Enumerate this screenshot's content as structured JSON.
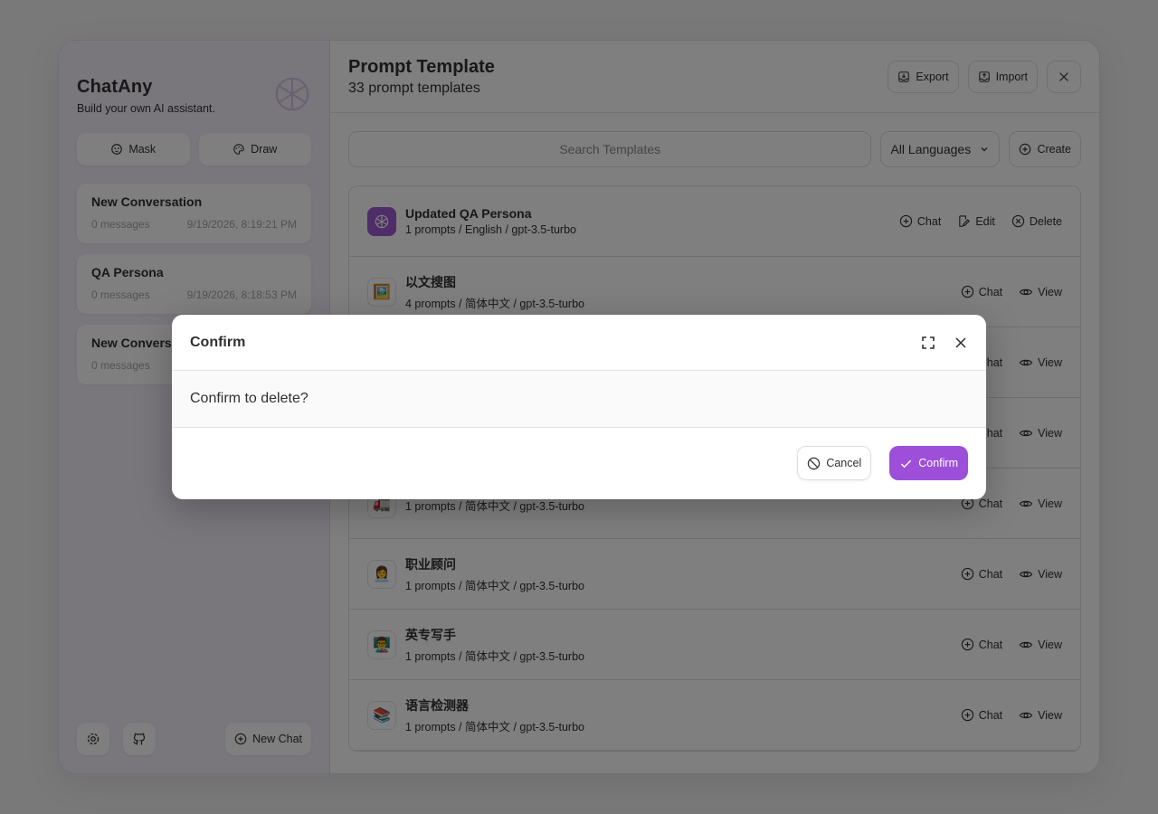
{
  "sidebar": {
    "brand_title": "ChatAny",
    "brand_subtitle": "Build your own AI assistant.",
    "mask_label": "Mask",
    "draw_label": "Draw",
    "chats": [
      {
        "title": "New Conversation",
        "count": "0 messages",
        "time": "9/19/2026, 8:19:21 PM"
      },
      {
        "title": "QA Persona",
        "count": "0 messages",
        "time": "9/19/2026, 8:18:53 PM"
      },
      {
        "title": "New Conversation",
        "count": "0 messages",
        "time": ""
      }
    ],
    "new_chat_label": "New Chat"
  },
  "main": {
    "title": "Prompt Template",
    "subtitle": "33 prompt templates",
    "export_label": "Export",
    "import_label": "Import",
    "search_placeholder": "Search Templates",
    "language_selected": "All Languages",
    "create_label": "Create",
    "templates": [
      {
        "name": "Updated QA Persona",
        "meta": "1 prompts / English / gpt-3.5-turbo",
        "icon": "openai-icon",
        "actions": [
          "Chat",
          "Edit",
          "Delete"
        ]
      },
      {
        "name": "以文搜图",
        "meta": "4 prompts / 简体中文 / gpt-3.5-turbo",
        "icon": "🖼️",
        "actions": [
          "Chat",
          "View"
        ]
      },
      {
        "name": "",
        "meta": "",
        "icon": "",
        "actions": [
          "Chat",
          "View"
        ]
      },
      {
        "name": "",
        "meta": "",
        "icon": "",
        "actions": [
          "Chat",
          "View"
        ]
      },
      {
        "name": "",
        "meta": "1 prompts / 简体中文 / gpt-3.5-turbo",
        "icon": "🚛",
        "actions": [
          "Chat",
          "View"
        ]
      },
      {
        "name": "职业顾问",
        "meta": "1 prompts / 简体中文 / gpt-3.5-turbo",
        "icon": "👩‍💼",
        "actions": [
          "Chat",
          "View"
        ]
      },
      {
        "name": "英专写手",
        "meta": "1 prompts / 简体中文 / gpt-3.5-turbo",
        "icon": "👨‍🏫",
        "actions": [
          "Chat",
          "View"
        ]
      },
      {
        "name": "语言检测器",
        "meta": "1 prompts / 简体中文 / gpt-3.5-turbo",
        "icon": "📚",
        "actions": [
          "Chat",
          "View"
        ]
      }
    ]
  },
  "modal": {
    "title": "Confirm",
    "message": "Confirm to delete?",
    "cancel_label": "Cancel",
    "confirm_label": "Confirm"
  },
  "colors": {
    "accent": "#9d4fd9",
    "sidebar_bg": "#f3ecf9"
  }
}
